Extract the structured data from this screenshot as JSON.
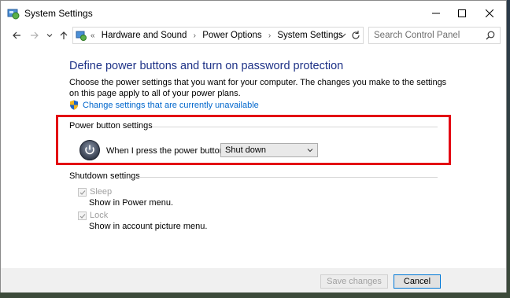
{
  "window": {
    "title": "System Settings"
  },
  "nav": {
    "breadcrumb": [
      "Hardware and Sound",
      "Power Options",
      "System Settings"
    ],
    "overflow": "«",
    "search_placeholder": "Search Control Panel"
  },
  "content": {
    "heading": "Define power buttons and turn on password protection",
    "description": "Choose the power settings that you want for your computer. The changes you make to the settings on this page apply to all of your power plans.",
    "change_link": "Change settings that are currently unavailable",
    "power_group": {
      "label": "Power button settings",
      "prompt": "When I press the power button:",
      "selected": "Shut down"
    },
    "shutdown_group": {
      "label": "Shutdown settings",
      "items": [
        {
          "label": "Sleep",
          "sub": "Show in Power menu.",
          "checked": true
        },
        {
          "label": "Lock",
          "sub": "Show in account picture menu.",
          "checked": true
        }
      ]
    }
  },
  "footer": {
    "save_label": "Save changes",
    "cancel_label": "Cancel"
  },
  "colors": {
    "heading": "#1e3287",
    "link": "#0066cc",
    "highlight": "#e30613"
  }
}
